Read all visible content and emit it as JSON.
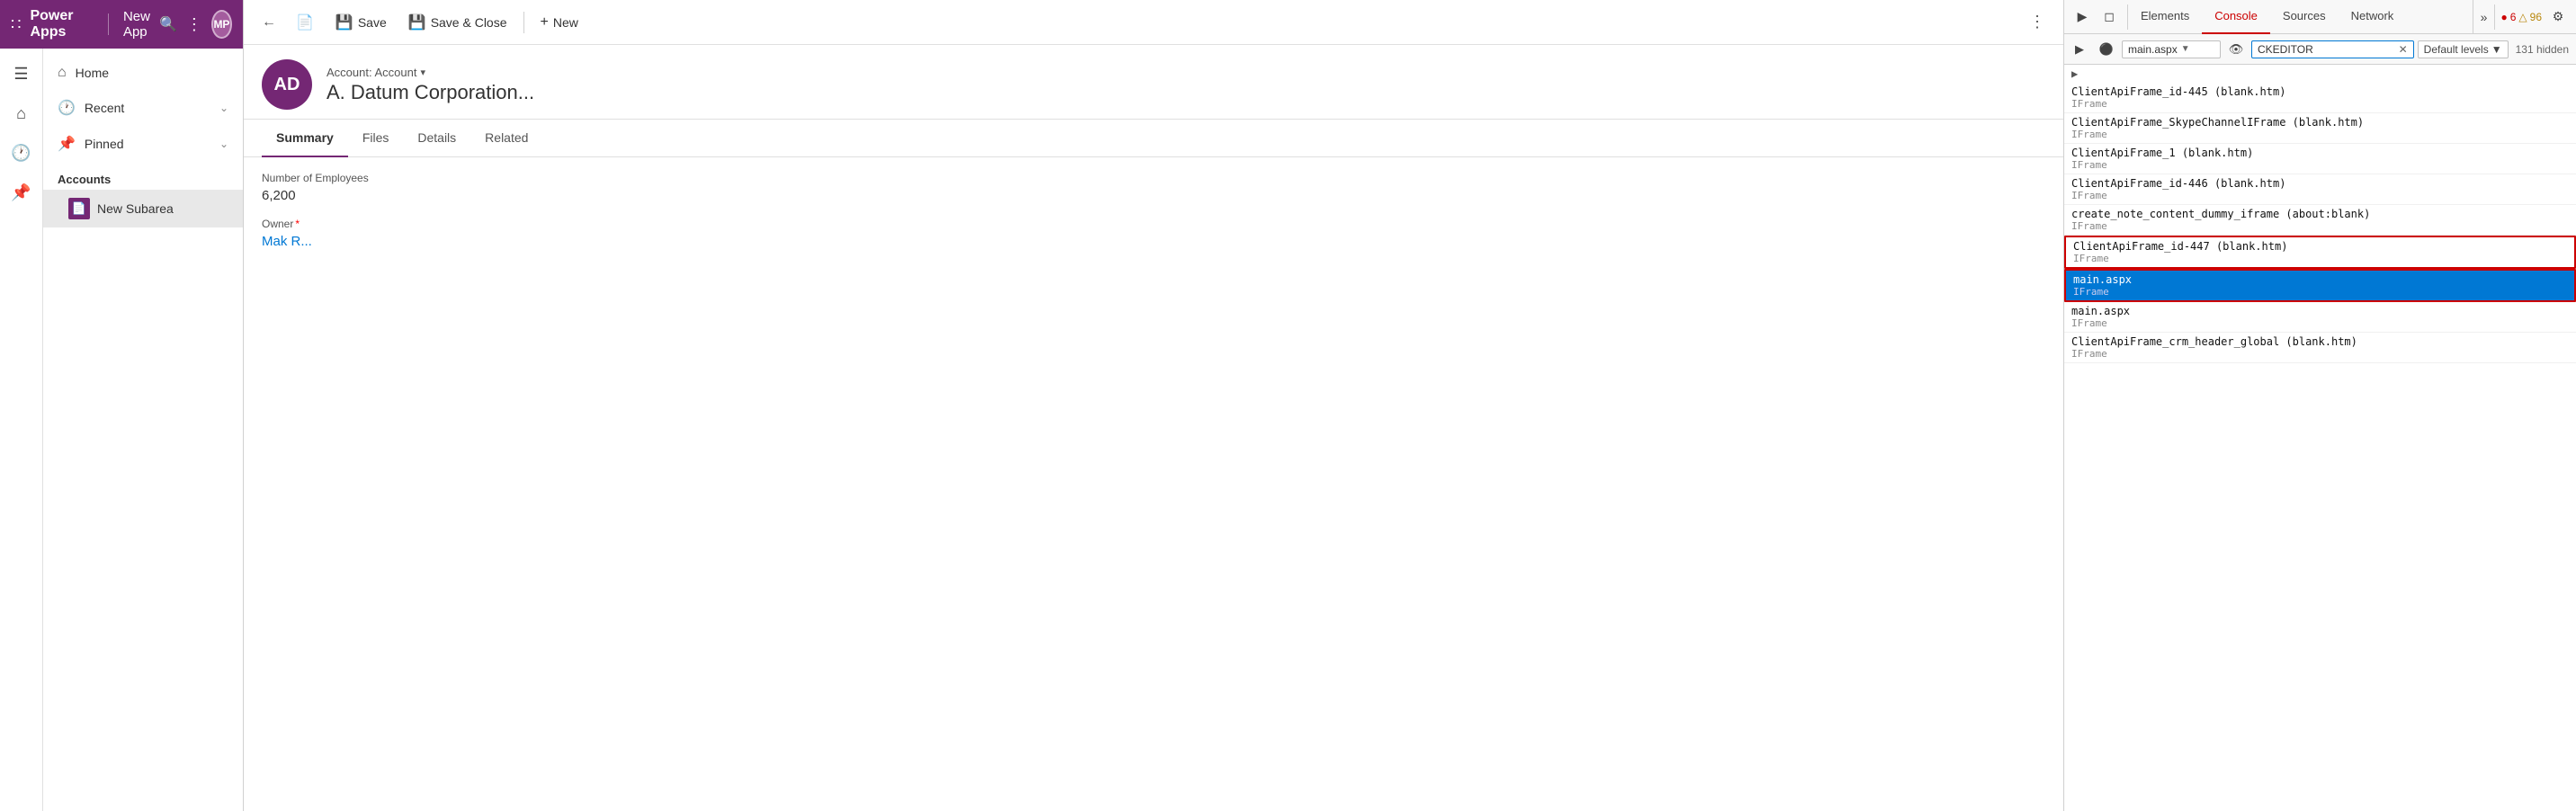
{
  "powerapps": {
    "logo": "Power Apps",
    "app_name": "New App",
    "search_icon": "🔍",
    "more_icon": "⋮",
    "avatar_text": "MP",
    "grid_icon": "⊞"
  },
  "sidebar": {
    "nav_icons": [
      {
        "name": "hamburger-icon",
        "icon": "☰"
      },
      {
        "name": "home-icon",
        "icon": "🏠"
      },
      {
        "name": "recent-icon",
        "icon": "🕐"
      },
      {
        "name": "pinned-icon",
        "icon": "📌"
      }
    ],
    "items": [
      {
        "label": "Home",
        "icon": "🏠",
        "chevron": false
      },
      {
        "label": "Recent",
        "icon": "🕐",
        "chevron": true
      },
      {
        "label": "Pinned",
        "icon": "📌",
        "chevron": true
      }
    ],
    "section_label": "Accounts",
    "subitem": {
      "label": "New Subarea",
      "icon_text": "📋"
    }
  },
  "toolbar": {
    "back_icon": "←",
    "record_icon": "📄",
    "save_label": "Save",
    "save_close_label": "Save & Close",
    "new_label": "New",
    "more_icon": "⋮"
  },
  "record": {
    "avatar_text": "AD",
    "type_label": "Account: Account",
    "type_chevron": "▾",
    "name": "A. Datum Corporation...",
    "tabs": [
      "Summary",
      "Files",
      "Details",
      "Related"
    ],
    "active_tab": "Summary",
    "fields": [
      {
        "label": "Number of Employees",
        "value": "6,200",
        "required": false,
        "is_link": false
      },
      {
        "label": "Owner",
        "value": "Mak R...",
        "required": true,
        "is_link": true
      }
    ]
  },
  "devtools": {
    "tabs": [
      "Elements",
      "Console",
      "Sources",
      "Network"
    ],
    "active_tab": "Console",
    "more_label": "»",
    "error_icon": "🔴",
    "error_count": "6",
    "warning_icon": "⚠",
    "warning_count": "96",
    "settings_icon": "⚙",
    "secondary": {
      "play_icon": "▶",
      "stop_icon": "⊘",
      "source_value": "main.aspx",
      "eye_icon": "👁",
      "filter_value": "CKEDITOR",
      "levels_label": "Default levels",
      "hidden_count": "131 hidden"
    },
    "log_items": [
      {
        "name": "ClientApiFrame_id-445 (blank.htm)",
        "type": "IFrame",
        "selected": false,
        "bordered": false
      },
      {
        "name": "ClientApiFrame_SkypeChannelIFrame (blank.htm)",
        "type": "IFrame",
        "selected": false,
        "bordered": false
      },
      {
        "name": "ClientApiFrame_1 (blank.htm)",
        "type": "IFrame",
        "selected": false,
        "bordered": false
      },
      {
        "name": "ClientApiFrame_id-446 (blank.htm)",
        "type": "IFrame",
        "selected": false,
        "bordered": false
      },
      {
        "name": "create_note_content_dummy_iframe (about:blank)",
        "type": "IFrame",
        "selected": false,
        "bordered": false
      },
      {
        "name": "ClientApiFrame_id-447 (blank.htm)",
        "type": "IFrame",
        "selected": false,
        "bordered": true
      },
      {
        "name": "main.aspx",
        "type": "IFrame",
        "selected": true,
        "bordered": true
      },
      {
        "name": "main.aspx",
        "type": "IFrame",
        "selected": false,
        "bordered": false
      },
      {
        "name": "ClientApiFrame_crm_header_global (blank.htm)",
        "type": "IFrame",
        "selected": false,
        "bordered": false
      }
    ]
  }
}
